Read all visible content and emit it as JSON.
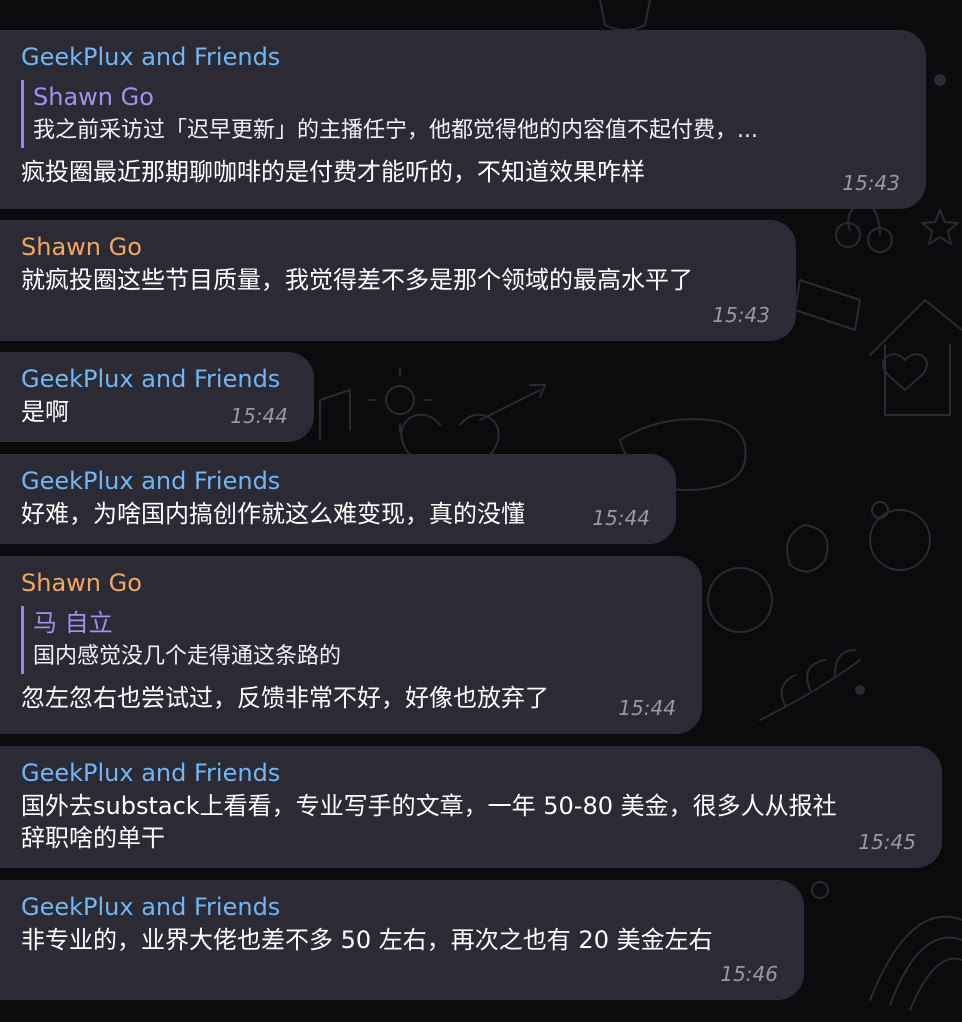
{
  "colors": {
    "background": "#0b0b0d",
    "bubble": "#2c2a35",
    "sender_blue": "#72b6f4",
    "sender_orange": "#eea766",
    "reply_purple": "#a78ff0",
    "timestamp": "#9a98a4"
  },
  "messages": [
    {
      "sender": "GeekPlux and Friends",
      "reply": {
        "name": "Shawn Go",
        "text": "我之前采访过「迟早更新」的主播任宁，他都觉得他的内容值不起付费，..."
      },
      "lines": [
        "疯投圈最近那期聊咖啡的是付费才能听的，不知道效果咋样"
      ],
      "time": "15:43"
    },
    {
      "sender": "Shawn Go",
      "lines": [
        "就疯投圈这些节目质量，我觉得差不多是那个领域的最高水平了"
      ],
      "time": "15:43"
    },
    {
      "sender": "GeekPlux and Friends",
      "lines": [
        "是啊"
      ],
      "time": "15:44"
    },
    {
      "sender": "GeekPlux and Friends",
      "lines": [
        "好难，为啥国内搞创作就这么难变现，真的没懂"
      ],
      "time": "15:44"
    },
    {
      "sender": "Shawn Go",
      "reply": {
        "name": "马 自立",
        "text": "国内感觉没几个走得通这条路的"
      },
      "lines": [
        "忽左忽右也尝试过，反馈非常不好，好像也放弃了"
      ],
      "time": "15:44"
    },
    {
      "sender": "GeekPlux and Friends",
      "lines": [
        "国外去substack上看看，专业写手的文章，一年 50-80 美金，很多人从报社",
        "辞职啥的单干"
      ],
      "time": "15:45"
    },
    {
      "sender": "GeekPlux and Friends",
      "lines": [
        "非专业的，业界大佬也差不多 50 左右，再次之也有 20 美金左右"
      ],
      "time": "15:46"
    }
  ]
}
